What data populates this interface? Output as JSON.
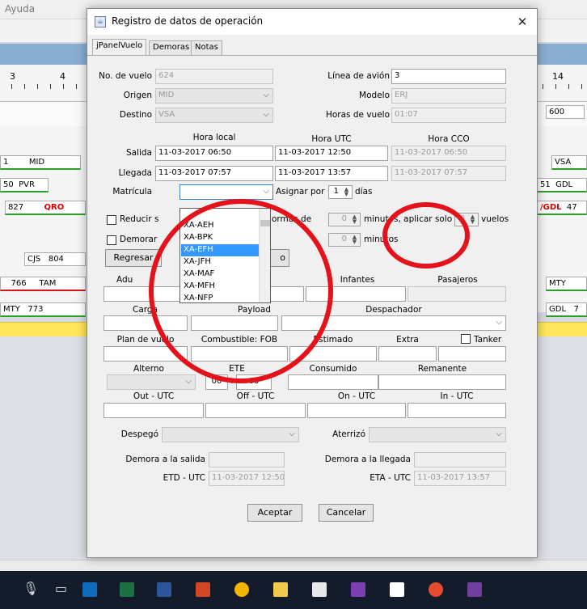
{
  "background": {
    "menu": [
      "Ayuda"
    ],
    "ruler": {
      "left": [
        "3",
        "4"
      ],
      "right": [
        "14"
      ]
    },
    "header_value": "600",
    "left_rows": [
      {
        "a": "1",
        "b": "MID"
      },
      {
        "a": "50",
        "b": "PVR"
      },
      {
        "a": "827",
        "b": "QRO"
      },
      {
        "a": "CJS",
        "b": "804"
      },
      {
        "a": "766",
        "b": "TAM"
      },
      {
        "a": "MTY",
        "b": "773"
      }
    ],
    "right_rows": [
      {
        "a": "VSA"
      },
      {
        "a": "51",
        "b": "GDL"
      },
      {
        "a": "/GDL",
        "b": "47"
      },
      {
        "a": "MTY"
      },
      {
        "a": "GDL",
        "b": "7"
      }
    ]
  },
  "dialog": {
    "title": "Registro de datos de operación",
    "tabs": [
      "jPanelVuelo",
      "Demoras",
      "Notas"
    ],
    "no_vuelo": {
      "label": "No. de vuelo",
      "value": "624"
    },
    "linea_avion": {
      "label": "Línea de avión",
      "value": "3"
    },
    "origen": {
      "label": "Origen",
      "value": "MID"
    },
    "modelo": {
      "label": "Modelo",
      "value": "ERJ"
    },
    "destino": {
      "label": "Destino",
      "value": "VSA"
    },
    "horas_vuelo": {
      "label": "Horas de vuelo",
      "value": "01:07"
    },
    "col_headers": {
      "local": "Hora local",
      "utc": "Hora UTC",
      "cco": "Hora CCO"
    },
    "salida": {
      "label": "Salida",
      "local": "11-03-2017 06:50",
      "utc": "11-03-2017 12:50",
      "cco": "11-03-2017 06:50"
    },
    "llegada": {
      "label": "Llegada",
      "local": "11-03-2017 07:57",
      "utc": "11-03-2017 13:57",
      "cco": "11-03-2017 07:57"
    },
    "matricula": {
      "label": "Matrícula",
      "value": ""
    },
    "asignar": {
      "label": "Asignar por",
      "value": "1",
      "unit": "días"
    },
    "dropdown": {
      "items": [
        "XA-AEH",
        "XA-BPK",
        "XA-EFH",
        "XA-JFH",
        "XA-MAF",
        "XA-MFH",
        "XA-NFP"
      ],
      "selected_index": 2
    },
    "reducir": {
      "label": "Reducir s",
      "suffix": "ormas de",
      "value": "0",
      "unit": "minutos, aplicar solo a",
      "vuelos_value": "0",
      "vuelos_label": "vuelos"
    },
    "demorar": {
      "label": "Demorar",
      "value": "0",
      "unit": "minutos"
    },
    "regresar": {
      "label": "Regresar",
      "tail": "o"
    },
    "pax_headers": {
      "adultos": "Adu",
      "infantes": "Infantes",
      "pasajeros": "Pasajeros"
    },
    "carga_headers": {
      "carga": "Carga",
      "payload": "Payload",
      "despachador": "Despachador"
    },
    "plan_headers": {
      "plan": "Plan de vuelo",
      "combustible": "Combustible: FOB",
      "estimado": "Estimado",
      "extra": "Extra",
      "tanker": "Tanker"
    },
    "alt_headers": {
      "alterno": "Alterno",
      "ete": "ETE",
      "consumido": "Consumido",
      "remanente": "Remanente"
    },
    "ete": {
      "h": "00",
      "m": "00"
    },
    "times_headers": {
      "out": "Out - UTC",
      "off": "Off - UTC",
      "on": "On - UTC",
      "in": "In - UTC"
    },
    "despego": {
      "label": "Despegó"
    },
    "aterrizo": {
      "label": "Aterrizó"
    },
    "demora_salida": {
      "label": "Demora a la salida"
    },
    "demora_llegada": {
      "label": "Demora a la llegada"
    },
    "etd": {
      "label": "ETD - UTC",
      "value": "11-03-2017 12:50"
    },
    "eta": {
      "label": "ETA - UTC",
      "value": "11-03-2017 13:57"
    },
    "aceptar": "Aceptar",
    "cancelar": "Cancelar"
  },
  "taskbar": {
    "icons": [
      "microphone-icon",
      "task-view-icon",
      "outlook-icon",
      "excel-icon",
      "word-icon",
      "powerpoint-icon",
      "chrome-icon",
      "file-explorer-icon",
      "store-icon",
      "pdf-app-icon",
      "sketch-app-icon",
      "cleaner-app-icon",
      "generic-app-icon"
    ],
    "colors": {
      "outlook": "#0f6cbd",
      "excel": "#1d7044",
      "word": "#2b579a",
      "powerpoint": "#d24726",
      "chrome": "#f4b400",
      "explorer": "#f2c94c",
      "pdf": "#7b3fb3",
      "cleaner": "#e54b2c"
    }
  },
  "colors": {
    "annotation": "#e4131b",
    "selection": "#3399ff",
    "highlight": "#ffe65a"
  }
}
